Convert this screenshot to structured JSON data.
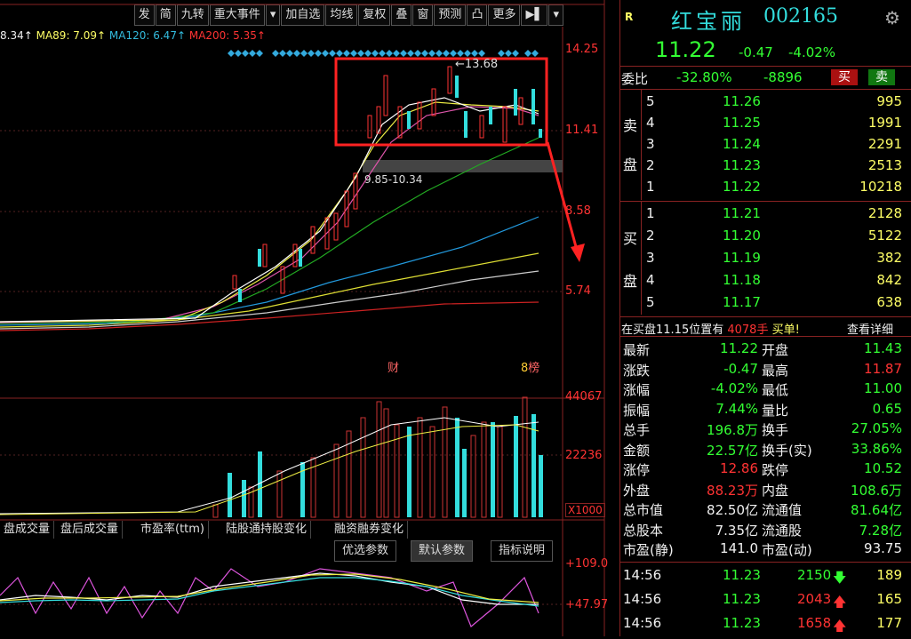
{
  "toolbar": {
    "items": [
      "发",
      "简",
      "九转",
      "重大事件",
      "▾",
      "加自选",
      "均线",
      "复权",
      "叠",
      "窗",
      "预测",
      "凸",
      "更多",
      "▶▌",
      "▾"
    ]
  },
  "ma_line": {
    "ma_a": "8.34↑",
    "ma89": "MA89: 7.09↑",
    "ma120": "MA120: 6.47↑",
    "ma200": "MA200: 5.35↑"
  },
  "price_axis": {
    "p1": "14.25",
    "p2": "11.41",
    "p3": "8.58",
    "p4": "5.74"
  },
  "chart_annotations": {
    "high": "13.68",
    "band": "9.85-10.34",
    "cai": "财",
    "bang": "榜"
  },
  "volume_axis": {
    "v1": "44067",
    "v2": "22236",
    "unit": "X1000"
  },
  "indicator_tabs": [
    "盘成交量",
    "盘后成交量",
    "市盈率(ttm)",
    "陆股通持股变化",
    "融资融券变化"
  ],
  "indicator_subtabs": [
    "优选参数",
    "默认参数",
    "指标说明"
  ],
  "indicator_axis": {
    "i1": "+109.0",
    "i2": "+47.97"
  },
  "quote": {
    "r_badge": "R",
    "name": "红宝丽",
    "code": "002165",
    "price": "11.22",
    "change": "-0.47",
    "pct": "-4.02%",
    "weibi_label": "委比",
    "weibi_value": "-32.80%",
    "weicha": "-8896",
    "buy_btn": "买",
    "sell_btn": "卖",
    "sell_label": [
      "卖",
      "盘"
    ],
    "buy_label": [
      "买",
      "盘"
    ],
    "asks": [
      {
        "lvl": "5",
        "price": "11.26",
        "vol": "995"
      },
      {
        "lvl": "4",
        "price": "11.25",
        "vol": "1991"
      },
      {
        "lvl": "3",
        "price": "11.24",
        "vol": "2291"
      },
      {
        "lvl": "2",
        "price": "11.23",
        "vol": "2513"
      },
      {
        "lvl": "1",
        "price": "11.22",
        "vol": "10218"
      }
    ],
    "bids": [
      {
        "lvl": "1",
        "price": "11.21",
        "vol": "2128"
      },
      {
        "lvl": "2",
        "price": "11.20",
        "vol": "5122"
      },
      {
        "lvl": "3",
        "price": "11.19",
        "vol": "382"
      },
      {
        "lvl": "4",
        "price": "11.18",
        "vol": "842"
      },
      {
        "lvl": "5",
        "price": "11.17",
        "vol": "638"
      }
    ],
    "notice_a": "在买盘11.15位置有",
    "notice_b": "4078手",
    "notice_c": "买单!",
    "notice_link": "查看详细",
    "stats": [
      {
        "l1": "最新",
        "v1": "11.22",
        "l2": "开盘",
        "v2": "11.43"
      },
      {
        "l1": "涨跌",
        "v1": "-0.47",
        "l2": "最高",
        "v2": "11.87"
      },
      {
        "l1": "涨幅",
        "v1": "-4.02%",
        "l2": "最低",
        "v2": "11.00"
      },
      {
        "l1": "振幅",
        "v1": "7.44%",
        "l2": "量比",
        "v2": "0.65"
      },
      {
        "l1": "总手",
        "v1": "196.8万",
        "l2": "换手",
        "v2": "27.05%"
      },
      {
        "l1": "金额",
        "v1": "22.57亿",
        "l2": "换手(实)",
        "v2": "33.86%"
      },
      {
        "l1": "涨停",
        "v1": "12.86",
        "l2": "跌停",
        "v2": "10.52"
      },
      {
        "l1": "外盘",
        "v1": "88.23万",
        "l2": "内盘",
        "v2": "108.6万"
      },
      {
        "l1": "总市值",
        "v1": "82.50亿",
        "l2": "流通值",
        "v2": "81.64亿"
      },
      {
        "l1": "总股本",
        "v1": "7.35亿",
        "l2": "流通股",
        "v2": "7.28亿"
      },
      {
        "l1": "市盈(静)",
        "v1": "141.0",
        "l2": "市盈(动)",
        "v2": "93.75"
      }
    ],
    "ticks": [
      {
        "time": "14:56",
        "price": "11.23",
        "vol": "2150",
        "dir": "down",
        "count": "189"
      },
      {
        "time": "14:56",
        "price": "11.23",
        "vol": "2043",
        "dir": "up",
        "count": "165"
      },
      {
        "time": "14:56",
        "price": "11.23",
        "vol": "1658",
        "dir": "up",
        "count": "177"
      }
    ]
  },
  "colors": {
    "up": "#ff3333",
    "down": "#33ff33",
    "cyan": "#33dddd",
    "frame": "#882222"
  }
}
